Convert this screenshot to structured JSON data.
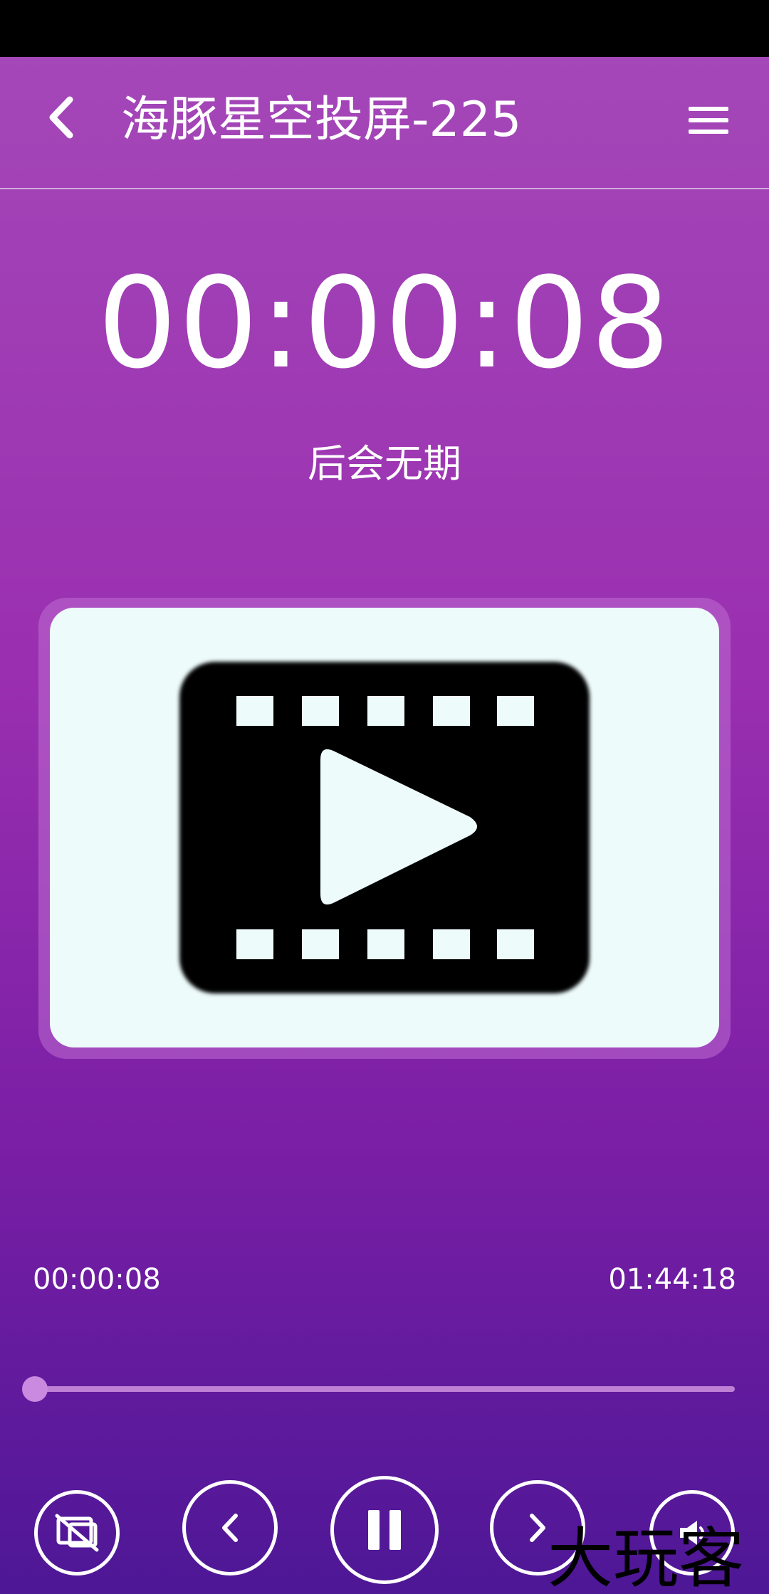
{
  "header": {
    "title": "海豚星空投屏-225",
    "back_icon": "chevron-left-icon",
    "menu_icon": "hamburger-menu-icon"
  },
  "player": {
    "elapsed_display": "00:00:08",
    "track_title": "后会无期",
    "current_time": "00:00:08",
    "total_time": "01:44:18",
    "progress_fraction": 0.0013
  },
  "cover": {
    "icon": "video-film-play-icon"
  },
  "controls": [
    {
      "name": "stop-cast-button",
      "icon": "screen-cast-off-icon"
    },
    {
      "name": "previous-button",
      "icon": "chevron-left-icon"
    },
    {
      "name": "pause-button",
      "icon": "pause-icon"
    },
    {
      "name": "next-button",
      "icon": "chevron-right-icon"
    },
    {
      "name": "volume-button",
      "icon": "volume-icon"
    }
  ],
  "colors": {
    "gradient_top": "#a447b8",
    "gradient_bottom": "#4d1796",
    "cover_background": "#eefbfb"
  },
  "watermark": {
    "text": "大玩客"
  }
}
